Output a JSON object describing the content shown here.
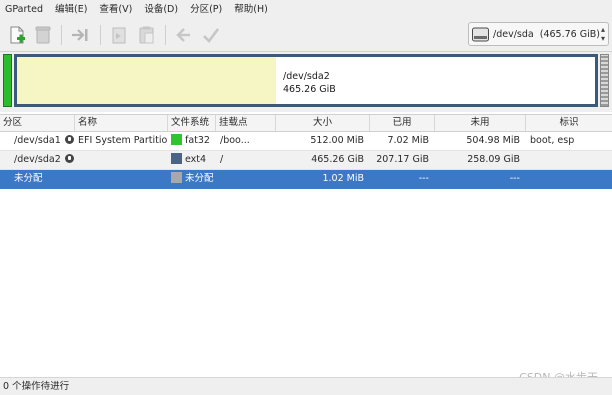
{
  "menu": [
    "GParted",
    "编辑(E)",
    "查看(V)",
    "设备(D)",
    "分区(P)",
    "帮助(H)"
  ],
  "toolbar": {
    "icons": [
      "new-partition",
      "delete-partition",
      "resize-move",
      "copy",
      "paste",
      "undo",
      "apply"
    ]
  },
  "device": {
    "label": "/dev/sda",
    "size": "(465.76 GiB)"
  },
  "diskmap": {
    "label_name": "/dev/sda2",
    "label_size": "465.26 GiB",
    "colors": {
      "border": "#3b5a7a",
      "used": "#f6f6c4",
      "fat32": "#2bbd2b"
    }
  },
  "table": {
    "headers": [
      "分区",
      "名称",
      "文件系统",
      "挂载点",
      "大小",
      "已用",
      "未用",
      "标识"
    ],
    "rows": [
      {
        "partition": "/dev/sda1",
        "name": "EFI System Partition",
        "fs": "fat32",
        "fs_color": "#2ec52e",
        "mount": "/boo...",
        "size": "512.00 MiB",
        "used": "7.02 MiB",
        "unused": "504.98 MiB",
        "flags": "boot, esp",
        "locked": true
      },
      {
        "partition": "/dev/sda2",
        "name": "",
        "fs": "ext4",
        "fs_color": "#4a6487",
        "mount": "/",
        "size": "465.26 GiB",
        "used": "207.17 GiB",
        "unused": "258.09 GiB",
        "flags": "",
        "locked": true
      },
      {
        "partition": "未分配",
        "name": "",
        "fs": "未分配",
        "fs_color": "#a8a8a8",
        "mount": "",
        "size": "1.02 MiB",
        "used": "---",
        "unused": "---",
        "flags": "",
        "locked": false
      }
    ]
  },
  "status": "0 个操作待进行",
  "watermark": "CSDN @水步天"
}
